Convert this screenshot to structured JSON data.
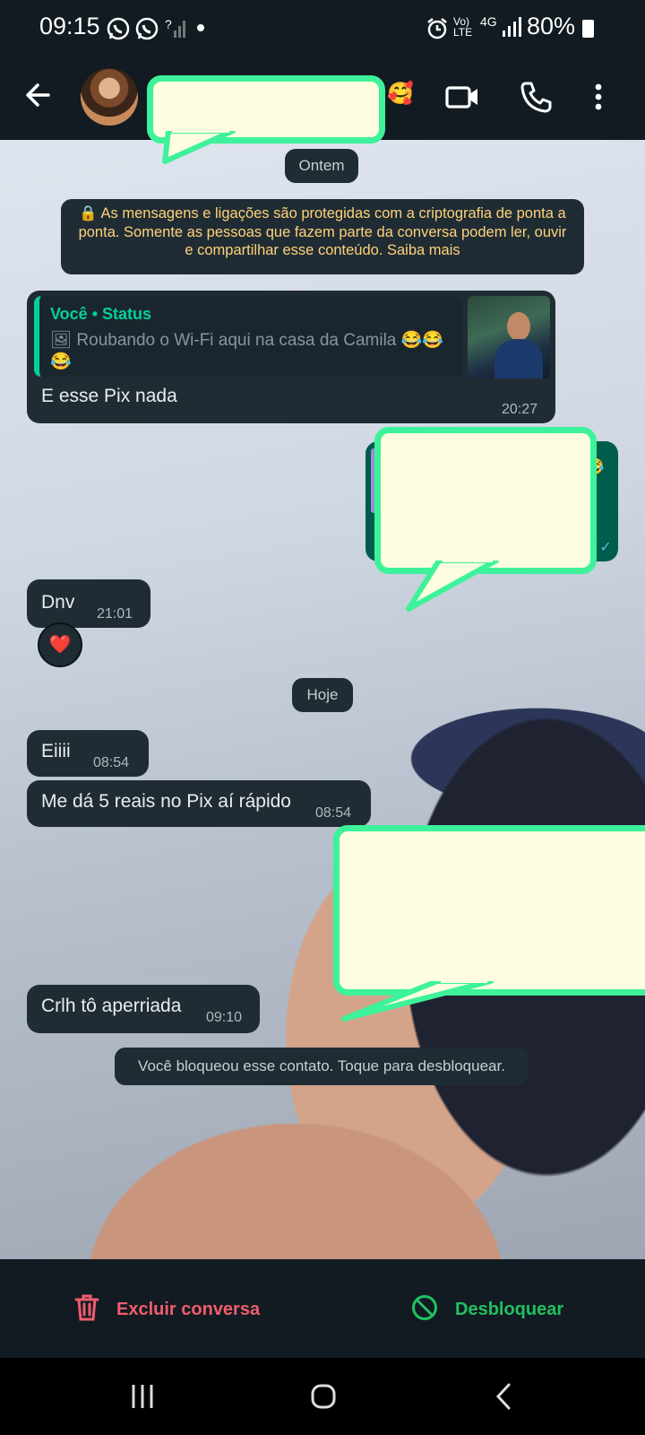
{
  "status_bar": {
    "time": "09:15",
    "left_icons": [
      "whatsapp-icon",
      "whatsapp-icon",
      "signal-unknown-icon",
      "dot-icon"
    ],
    "right_icons": [
      "alarm-icon",
      "volte-icon",
      "4g-icon",
      "signal-icon"
    ],
    "volte_label": "Vo) LTE",
    "network_label": "4G",
    "battery": "80%"
  },
  "header": {
    "emoji": "🥰"
  },
  "chat": {
    "date_yesterday": "Ontem",
    "encryption_notice": "🔒 As mensagens e ligações são protegidas com a criptografia de ponta a ponta. Somente as pessoas que fazem parte da conversa podem ler, ouvir e compartilhar esse conteúdo. Saiba mais",
    "reply_msg": {
      "quote_author": "Você • Status",
      "quote_text": "🖼 Roubando o Wi-Fi aqui na casa da Camila 😂😂😂",
      "text": "E esse Pix nada",
      "time": "20:27"
    },
    "msg_dnv": {
      "text": "Dnv",
      "time": "21:01",
      "reaction": "❤️"
    },
    "date_today": "Hoje",
    "msg_eiiii": {
      "text": "Eiiii",
      "time": "08:54"
    },
    "msg_pix": {
      "text": "Me dá 5 reais no Pix aí rápido",
      "time": "08:54"
    },
    "msg_crlh": {
      "text": "Crlh tô aperriada",
      "time": "09:10"
    },
    "blocked_notice": "Você bloqueou esse contato. Toque para desbloquear."
  },
  "bottom": {
    "delete_label": "Excluir conversa",
    "unblock_label": "Desbloquear"
  },
  "colors": {
    "accent_green": "#21c063",
    "delete_red": "#f15c6d",
    "highlight_green": "#3df29a",
    "redaction_fill": "#fffde0"
  }
}
